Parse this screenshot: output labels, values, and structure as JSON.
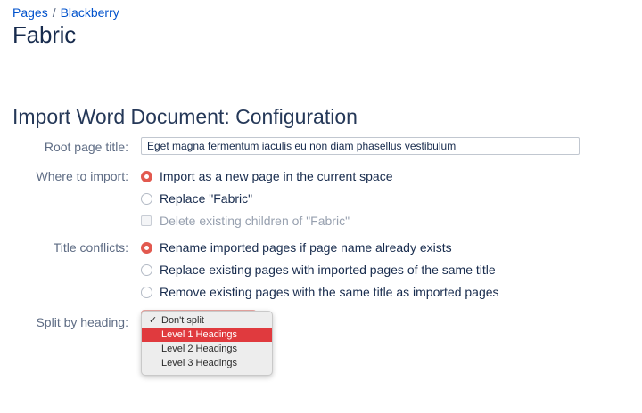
{
  "breadcrumb": {
    "items": [
      "Pages",
      "Blackberry"
    ],
    "separator": "/"
  },
  "page": {
    "title": "Fabric"
  },
  "section": {
    "title": "Import Word Document: Configuration"
  },
  "form": {
    "root_page_title": {
      "label": "Root page title:",
      "value": "Eget magna fermentum iaculis eu non diam phasellus vestibulum"
    },
    "where_to_import": {
      "label": "Where to import:",
      "options": [
        {
          "label": "Import as a new page in the current space",
          "checked": true
        },
        {
          "label": "Replace \"Fabric\"",
          "checked": false
        }
      ],
      "checkbox": {
        "label": "Delete existing children of \"Fabric\"",
        "checked": false,
        "disabled": true
      }
    },
    "title_conflicts": {
      "label": "Title conflicts:",
      "options": [
        {
          "label": "Rename imported pages if page name already exists",
          "checked": true
        },
        {
          "label": "Replace existing pages with imported pages of the same title",
          "checked": false
        },
        {
          "label": "Remove existing pages with the same title as imported pages",
          "checked": false
        }
      ]
    },
    "split_by_heading": {
      "label": "Split by heading:",
      "selected": "Don't split",
      "options": [
        "Don't split",
        "Level 1 Headings",
        "Level 2 Headings",
        "Level 3 Headings"
      ],
      "highlighted": "Level 1 Headings"
    }
  },
  "colors": {
    "accent_radio": "#e2594f",
    "dropdown_highlight": "#e03a3e",
    "link": "#0052cc",
    "section_title": "#253858"
  },
  "icons": {
    "selected_marker": "checkmark-icon"
  }
}
